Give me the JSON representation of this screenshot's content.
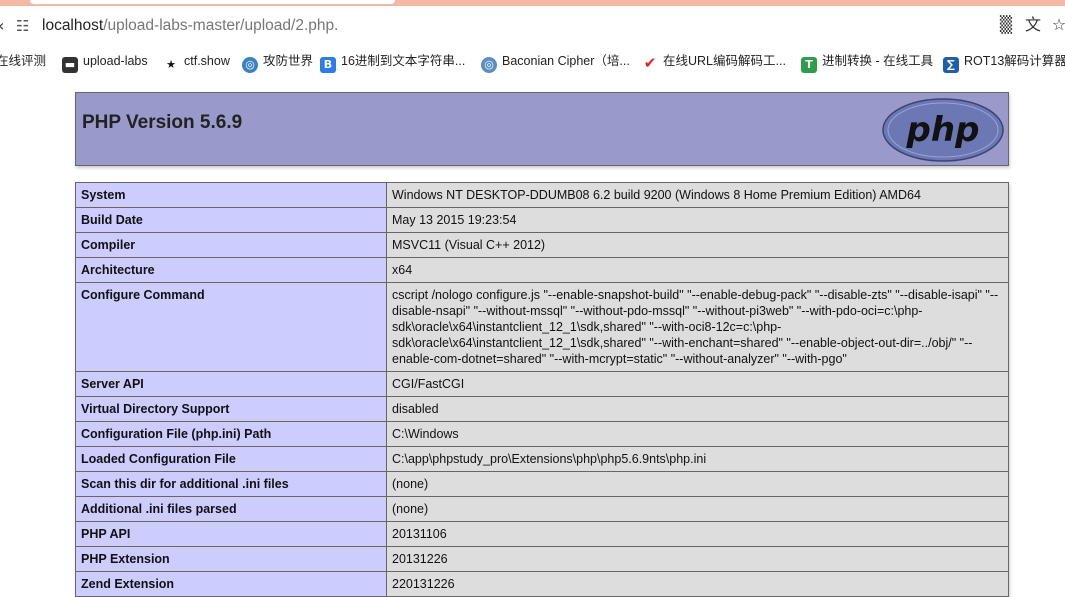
{
  "browser": {
    "url_host": "localhost",
    "url_path": "/upload-labs-master/upload/2.php.",
    "icons": [
      "back-icon",
      "site-info-icon",
      "qr-code-icon",
      "translate-icon",
      "star-icon"
    ]
  },
  "bookmarks": [
    {
      "label": "在线评测",
      "icon": "bookmark-icon"
    },
    {
      "label": "upload-labs",
      "icon": "folder-icon"
    },
    {
      "label": "ctf.show",
      "icon": "runner-icon"
    },
    {
      "label": "攻防世界",
      "icon": "globe-icon"
    },
    {
      "label": "16进制到文本字符串...",
      "icon": "b-logo-icon"
    },
    {
      "label": "Baconian Cipher（培...",
      "icon": "globe-icon"
    },
    {
      "label": "在线URL编码解码工...",
      "icon": "checkmark-icon"
    },
    {
      "label": "进制转换 - 在线工具",
      "icon": "t-logo-icon"
    },
    {
      "label": "ROT13解码计算器",
      "icon": "calc-icon"
    }
  ],
  "php": {
    "title": "PHP Version 5.6.9",
    "logo_text": "php",
    "rows": [
      {
        "key": "System",
        "value": "Windows NT DESKTOP-DDUMB08 6.2 build 9200 (Windows 8 Home Premium Edition) AMD64"
      },
      {
        "key": "Build Date",
        "value": "May 13 2015 19:23:54"
      },
      {
        "key": "Compiler",
        "value": "MSVC11 (Visual C++ 2012)"
      },
      {
        "key": "Architecture",
        "value": "x64"
      },
      {
        "key": "Configure Command",
        "value": "cscript /nologo configure.js \"--enable-snapshot-build\" \"--enable-debug-pack\" \"--disable-zts\" \"--disable-isapi\" \"--disable-nsapi\" \"--without-mssql\" \"--without-pdo-mssql\" \"--without-pi3web\" \"--with-pdo-oci=c:\\php-sdk\\oracle\\x64\\instantclient_12_1\\sdk,shared\" \"--with-oci8-12c=c:\\php-sdk\\oracle\\x64\\instantclient_12_1\\sdk,shared\" \"--with-enchant=shared\" \"--enable-object-out-dir=../obj/\" \"--enable-com-dotnet=shared\" \"--with-mcrypt=static\" \"--without-analyzer\" \"--with-pgo\""
      },
      {
        "key": "Server API",
        "value": "CGI/FastCGI"
      },
      {
        "key": "Virtual Directory Support",
        "value": "disabled"
      },
      {
        "key": "Configuration File (php.ini) Path",
        "value": "C:\\Windows"
      },
      {
        "key": "Loaded Configuration File",
        "value": "C:\\app\\phpstudy_pro\\Extensions\\php\\php5.6.9nts\\php.ini"
      },
      {
        "key": "Scan this dir for additional .ini files",
        "value": "(none)"
      },
      {
        "key": "Additional .ini files parsed",
        "value": "(none)"
      },
      {
        "key": "PHP API",
        "value": "20131106"
      },
      {
        "key": "PHP Extension",
        "value": "20131226"
      },
      {
        "key": "Zend Extension",
        "value": "220131226"
      }
    ]
  },
  "colors": {
    "header_bg": "#9999cc",
    "key_bg": "#ccccff",
    "value_bg": "#dddddd",
    "logo_bg": "#6c78b4",
    "tab_strip": "#f3b9a6"
  }
}
